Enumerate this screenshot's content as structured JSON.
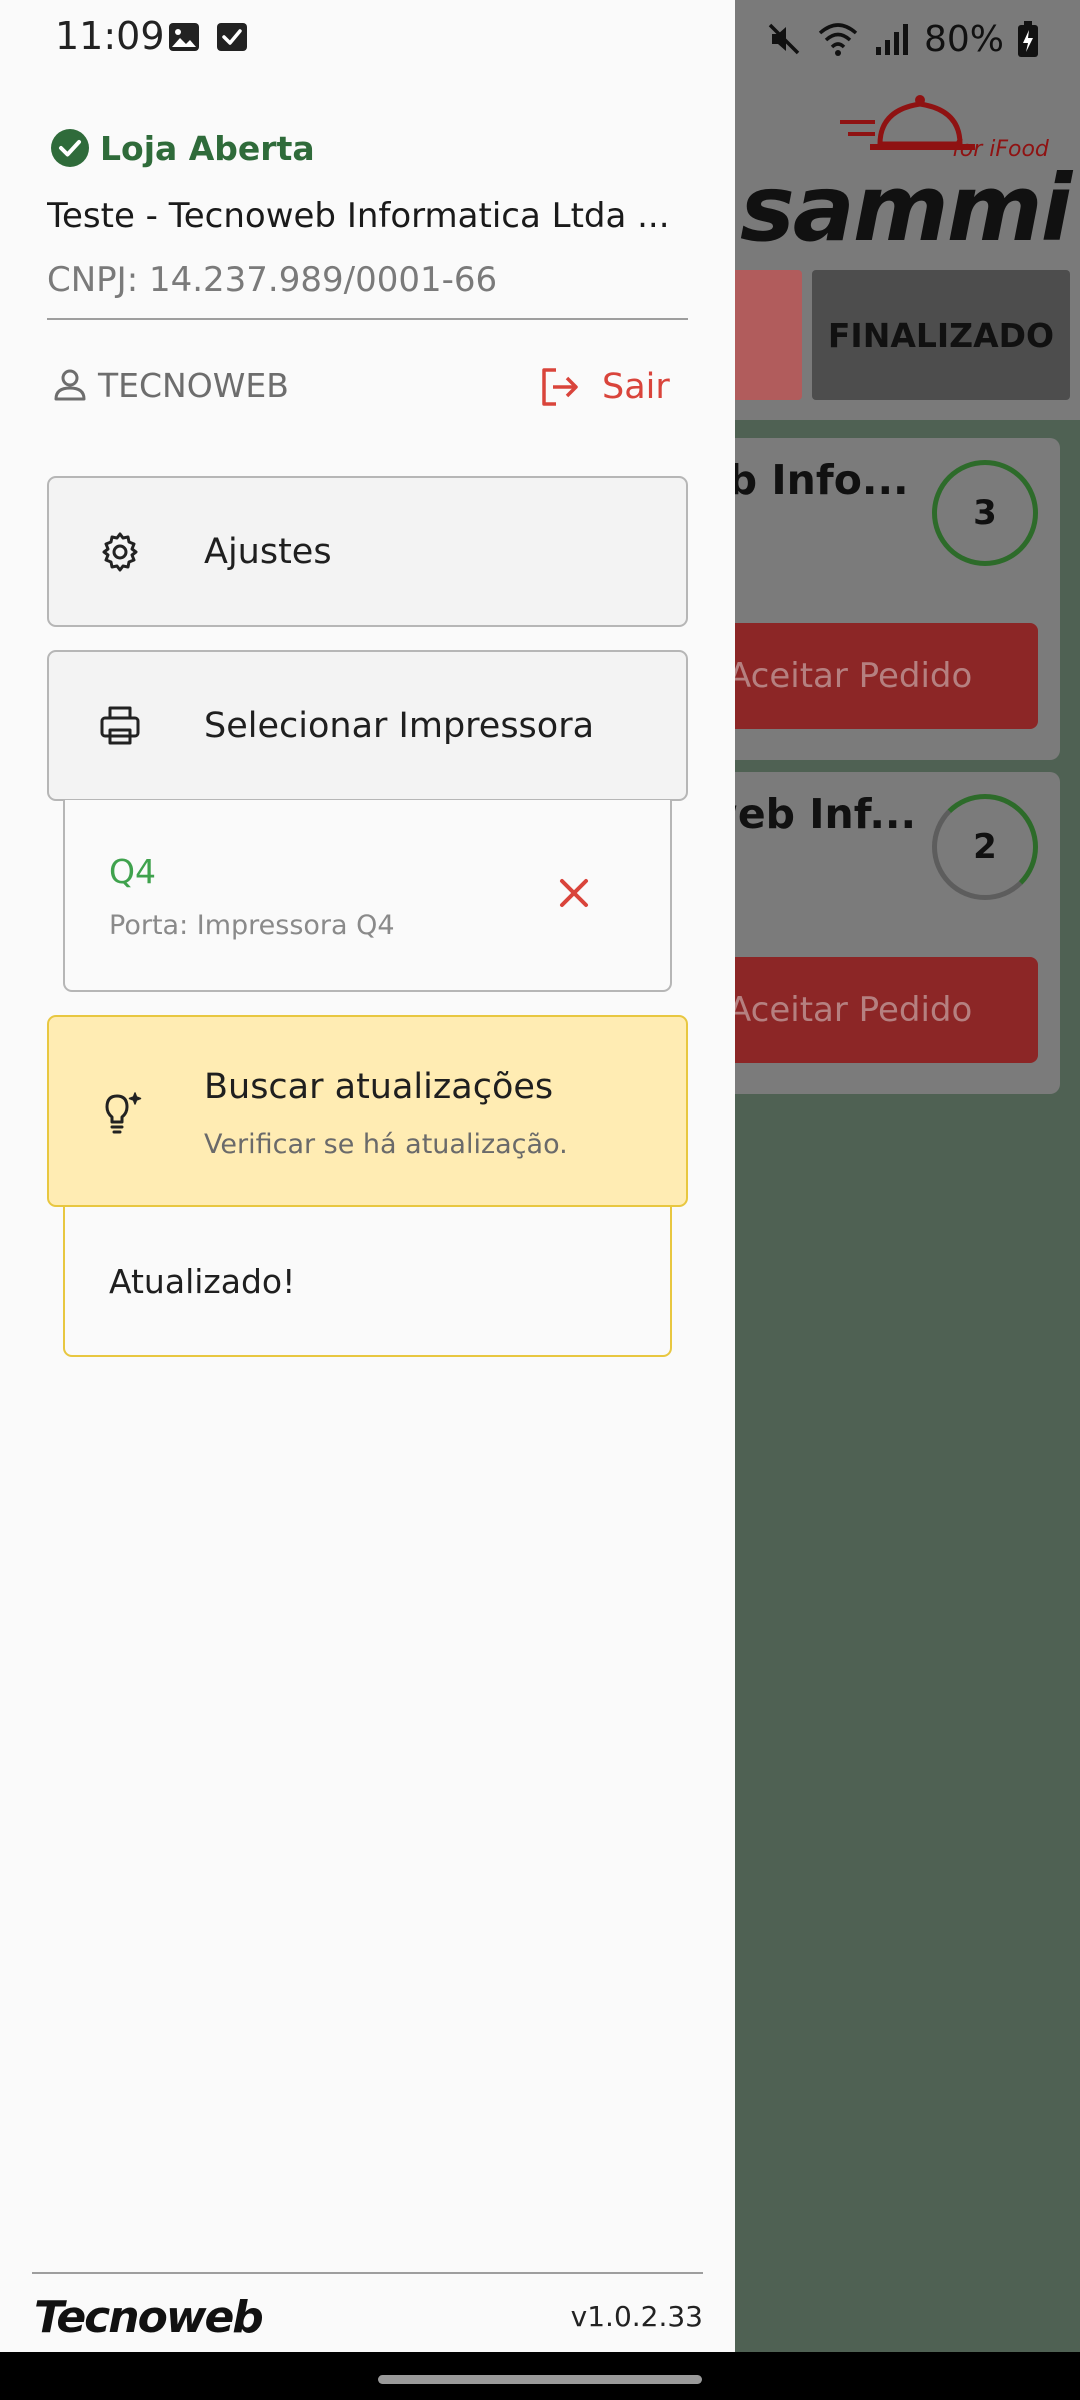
{
  "status_bar": {
    "time": "11:09",
    "battery": "80%"
  },
  "drawer": {
    "store_status": "Loja Aberta",
    "company_name": "Teste - Tecnoweb Informatica Ltda ...",
    "cnpj": "CNPJ: 14.237.989/0001-66",
    "user": "TECNOWEB",
    "logout_label": "Sair",
    "menu": {
      "settings_label": "Ajustes",
      "printer_label": "Selecionar Impressora"
    },
    "printer": {
      "name": "Q4",
      "port": "Porta: Impressora Q4"
    },
    "update": {
      "title": "Buscar atualizações",
      "subtitle": "Verificar se há atualização.",
      "status": "Atualizado!"
    },
    "footer": {
      "brand": "Tecnoweb",
      "version": "v1.0.2.33"
    }
  },
  "background": {
    "logo_text": "sammi",
    "logo_subtext": "for iFood",
    "tab_finalizado": "FINALIZADO",
    "orders": [
      {
        "title": "eb Info...",
        "count": "3",
        "action": "Aceitar Pedido"
      },
      {
        "title": "web Inf...",
        "count": "2",
        "action": "Aceitar Pedido"
      }
    ]
  },
  "colors": {
    "store_open": "#2f6b3a",
    "logout": "#d9443b",
    "printer_name": "#3fa24d",
    "update_bg": "#ffecb3",
    "update_border": "#e8c740"
  }
}
